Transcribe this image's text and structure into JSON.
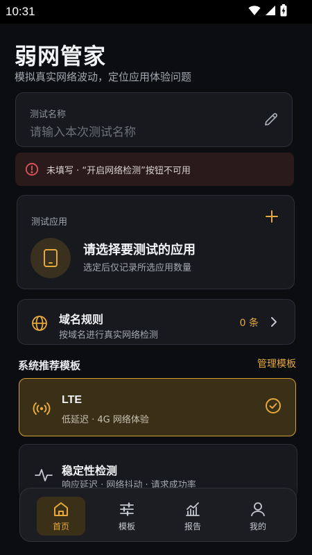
{
  "status_bar": {
    "time": "10:31"
  },
  "header": {
    "title": "弱网管家",
    "subtitle": "模拟真实网络波动，定位应用体验问题"
  },
  "test_name": {
    "label": "测试名称",
    "placeholder": "请输入本次测试名称"
  },
  "warning": {
    "text": "未填写 · “开启网络检测”按钮不可用"
  },
  "test_app": {
    "label": "测试应用",
    "title": "请选择要测试的应用",
    "hint": "选定后仅记录所选应用数量"
  },
  "domain_rules": {
    "title": "域名规则",
    "subtitle": "按域名进行真实网络检测",
    "count": "0 条"
  },
  "templates": {
    "section_title": "系统推荐模板",
    "manage_label": "管理模板",
    "items": [
      {
        "title": "LTE",
        "desc": "低延迟 · 4G 网络体验",
        "selected": true
      },
      {
        "title": "稳定性检测",
        "desc": "响应延迟 · 网络抖动 · 请求成功率",
        "selected": false
      }
    ]
  },
  "bottom_nav": {
    "items": [
      {
        "label": "首页",
        "icon": "home-icon",
        "active": true
      },
      {
        "label": "模板",
        "icon": "sliders-icon",
        "active": false
      },
      {
        "label": "报告",
        "icon": "chart-icon",
        "active": false
      },
      {
        "label": "我的",
        "icon": "user-icon",
        "active": false
      }
    ]
  },
  "colors": {
    "accent": "#e7a93a",
    "background": "#0b0d10",
    "card": "#17191e",
    "warning_bg": "#2a1a1c",
    "error_icon": "#e0555a"
  }
}
